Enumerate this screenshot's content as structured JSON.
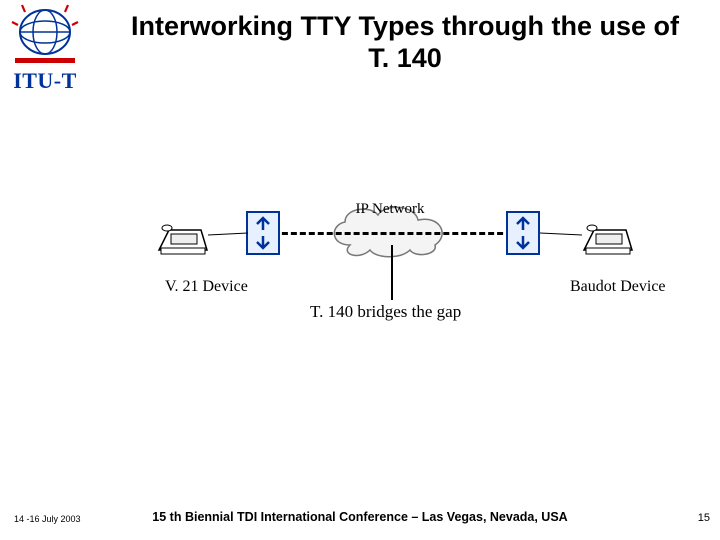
{
  "logo": {
    "text": "ITU-T"
  },
  "title": "Interworking TTY Types through the use of T. 140",
  "diagram": {
    "cloud_label": "IP Network",
    "left_device": "V. 21 Device",
    "right_device": "Baudot Device",
    "bridge_label": "T. 140 bridges the gap"
  },
  "footer": {
    "date": "14 -16 July 2003",
    "venue": "15 th Biennial TDI International Conference – Las Vegas, Nevada, USA",
    "page": "15"
  }
}
